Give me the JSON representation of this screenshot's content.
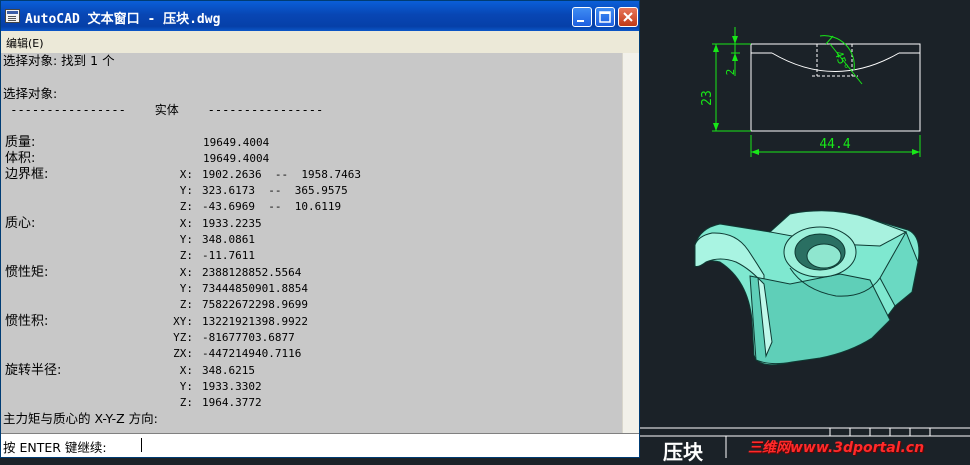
{
  "window": {
    "title": "AutoCAD 文本窗口 - 压块.dwg",
    "menu_label": "编辑(E)"
  },
  "output": {
    "line1": "选择对象: 找到 1 个",
    "line2": "选择对象:",
    "separator": " ----------------    实体    ----------------",
    "mass": {
      "label": "质量:",
      "value": "19649.4004"
    },
    "volume": {
      "label": "体积:",
      "value": "19649.4004"
    },
    "bbox": {
      "label": "边界框:",
      "x": "1902.2636  --  1958.7463",
      "y": "323.6173  --  365.9575",
      "z": "-43.6969  --  10.6119"
    },
    "centroid": {
      "label": "质心:",
      "x": "1933.2235",
      "y": "348.0861",
      "z": "-11.7611"
    },
    "moments": {
      "label": "惯性矩:",
      "x": "2388128852.5564",
      "y": "73444850901.8854",
      "z": "75822672298.9699"
    },
    "products": {
      "label": "惯性积:",
      "xy": "13221921398.9922",
      "yz": "-81677703.6877",
      "zx": "-447214940.7116"
    },
    "radii": {
      "label": "旋转半径:",
      "x": "348.6215",
      "y": "1933.3302",
      "z": "1964.3772"
    },
    "principal": "主力矩与质心的 X-Y-Z 方向:"
  },
  "axes": {
    "x": "X:",
    "y": "Y:",
    "z": "Z:",
    "xy": "XY:",
    "yz": "YZ:",
    "zx": "ZX:"
  },
  "command": {
    "prompt": "按 ENTER 键继续:"
  },
  "drawing": {
    "dim_height": "23",
    "dim_depth": "2",
    "dim_angle": "45°",
    "dim_width": "44.4",
    "title_block_text": "压块",
    "watermark": "三维网www.3dportal.cn"
  }
}
